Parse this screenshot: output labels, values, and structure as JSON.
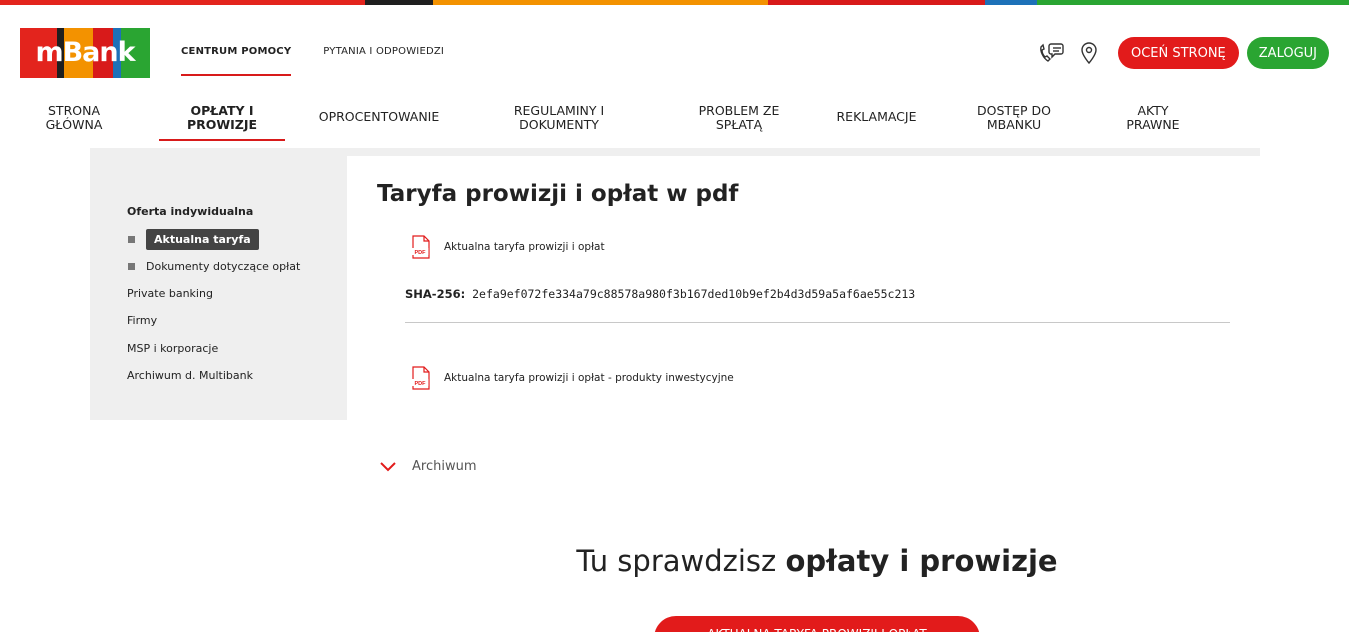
{
  "colors": {
    "topbar": [
      "#e3241d",
      "#1f1f1f",
      "#f39200",
      "#d81a1a",
      "#1d71b8",
      "#2aa532"
    ],
    "accent_red": "#e21b1b",
    "accent_green": "#2aa532"
  },
  "logo": {
    "text": "mBank"
  },
  "header": {
    "tabs": [
      {
        "label": "CENTRUM POMOCY",
        "active": true
      },
      {
        "label": "PYTANIA I ODPOWIEDZI",
        "active": false
      }
    ],
    "icons": [
      "phone-chat-icon",
      "location-pin-icon"
    ],
    "rate_button": "OCEŃ STRONĘ",
    "login_button": "ZALOGUJ"
  },
  "mainnav": {
    "items": [
      {
        "line1": "STRONA",
        "line2": "GŁÓWNA"
      },
      {
        "line1": "OPŁATY I",
        "line2": "PROWIZJE",
        "active": true
      },
      {
        "line1": "OPROCENTOWANIE",
        "line2": ""
      },
      {
        "line1": "REGULAMINY I",
        "line2": "DOKUMENTY"
      },
      {
        "line1": "PROBLEM ZE",
        "line2": "SPŁATĄ"
      },
      {
        "line1": "REKLAMACJE",
        "line2": ""
      },
      {
        "line1": "DOSTĘP DO",
        "line2": "MBANKU"
      },
      {
        "line1": "AKTY",
        "line2": "PRAWNE"
      }
    ]
  },
  "sidebar": {
    "heading": "Oferta indywidualna",
    "sub_items": [
      {
        "label": "Aktualna taryfa",
        "current": true
      },
      {
        "label": "Dokumenty dotyczące opłat",
        "current": false
      }
    ],
    "items": [
      "Private banking",
      "Firmy",
      "MSP i korporacje",
      "Archiwum d. Multibank"
    ]
  },
  "main": {
    "title": "Taryfa prowizji i opłat w pdf",
    "documents": [
      {
        "label": "Aktualna taryfa prowizji i opłat",
        "icon": "pdf-icon"
      },
      {
        "label": "Aktualna taryfa prowizji i opłat - produkty inwestycyjne",
        "icon": "pdf-icon"
      }
    ],
    "sha_label": "SHA-256:",
    "sha_value": "2efa9ef072fe334a79c88578a980f3b167ded10b9ef2b4d3d59a5af6ae55c213",
    "archive_label": "Archiwum",
    "pdf_text": "PDF"
  },
  "promo": {
    "text_normal": "Tu sprawdzisz ",
    "text_bold": "opłaty i prowizje",
    "button": "AKTUALNA TARYFA PROWIZJI I OPŁAT"
  }
}
